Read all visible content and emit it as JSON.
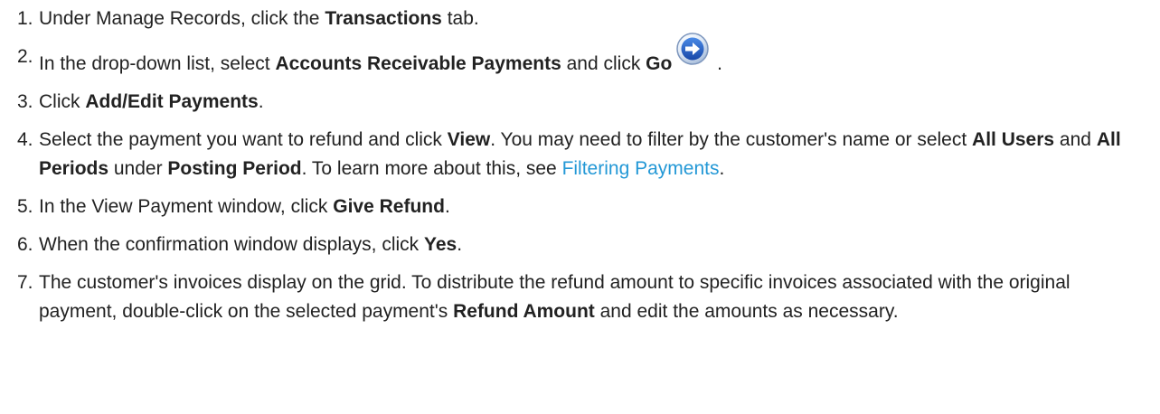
{
  "steps": [
    {
      "number": "1.",
      "t1": "Under Manage Records, click the ",
      "b1": "Transactions",
      "t2": " tab."
    },
    {
      "number": "2.",
      "t1": "In the drop-down list, select ",
      "b1": "Accounts Receivable Payments",
      "t2": " and click ",
      "b2": "Go",
      "icon": "go-arrow-icon",
      "t3": " ."
    },
    {
      "number": "3.",
      "t1": "Click ",
      "b1": "Add/Edit Payments",
      "t2": "."
    },
    {
      "number": "4.",
      "t1": "Select the payment you want to refund and click ",
      "b1": "View",
      "t2": ". You may need to filter by the customer's name or select ",
      "b2": "All Users",
      "t3": " and ",
      "b3": "All Periods",
      "t4": " under ",
      "b4": "Posting Period",
      "t5": ". To learn more about this, see ",
      "link": "Filtering Payments",
      "t6": "."
    },
    {
      "number": "5.",
      "t1": "In the View Payment window, click ",
      "b1": "Give Refund",
      "t2": "."
    },
    {
      "number": "6.",
      "t1": "When the confirmation window displays, click ",
      "b1": "Yes",
      "t2": "."
    },
    {
      "number": "7.",
      "t1": "The customer's invoices display on the grid. To distribute the refund amount to specific invoices associated with the original payment, double-click on the selected payment's ",
      "b1": "Refund Amount",
      "t2": " and edit the amounts as necessary."
    }
  ],
  "colors": {
    "text": "#222222",
    "link": "#2398d6",
    "icon_blue": "#1f63c7"
  }
}
